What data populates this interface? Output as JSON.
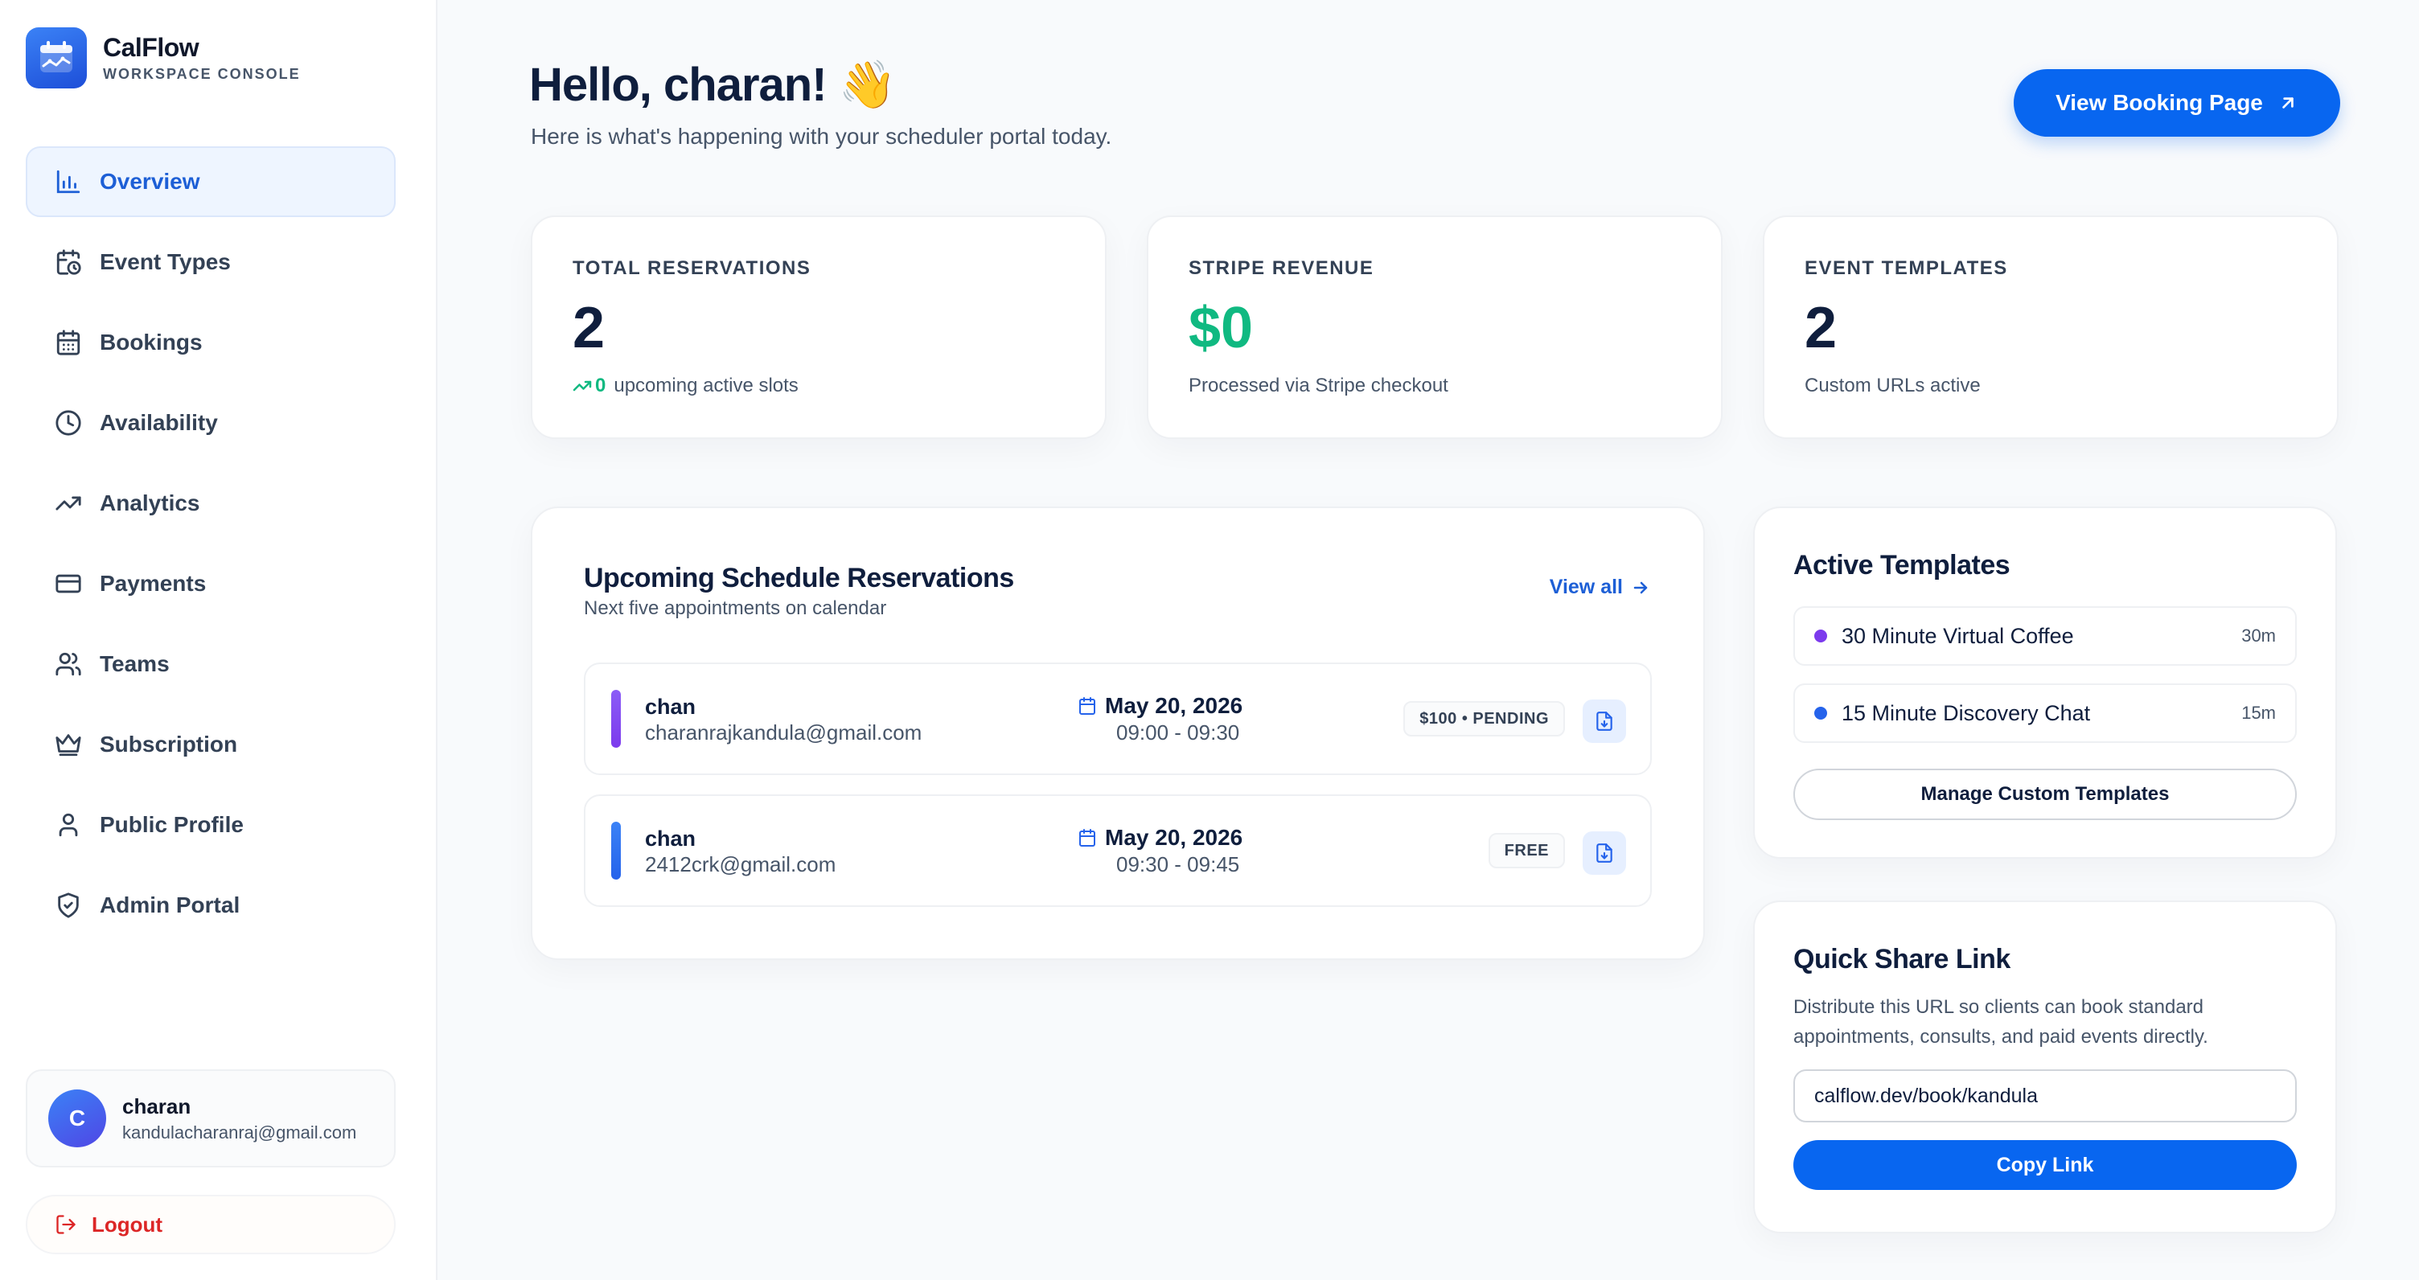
{
  "brand": {
    "name": "CalFlow",
    "subtitle": "WORKSPACE CONSOLE"
  },
  "sidebar": {
    "items": [
      {
        "label": "Overview",
        "icon": "bar-chart-icon",
        "active": true
      },
      {
        "label": "Event Types",
        "icon": "calendar-clock-icon"
      },
      {
        "label": "Bookings",
        "icon": "calendar-icon"
      },
      {
        "label": "Availability",
        "icon": "clock-icon"
      },
      {
        "label": "Analytics",
        "icon": "trending-up-icon"
      },
      {
        "label": "Payments",
        "icon": "credit-card-icon"
      },
      {
        "label": "Teams",
        "icon": "users-icon"
      },
      {
        "label": "Subscription",
        "icon": "crown-icon"
      },
      {
        "label": "Public Profile",
        "icon": "user-icon"
      },
      {
        "label": "Admin Portal",
        "icon": "shield-icon"
      }
    ],
    "user": {
      "initial": "C",
      "name": "charan",
      "email": "kandulacharanraj@gmail.com"
    },
    "logout_label": "Logout"
  },
  "header": {
    "greeting": "Hello, charan! 👋",
    "subtitle": "Here is what's happening with your scheduler portal today.",
    "view_booking_label": "View Booking Page"
  },
  "stats": [
    {
      "label": "TOTAL RESERVATIONS",
      "value": "2",
      "trend": "0",
      "foot": "upcoming active slots"
    },
    {
      "label": "STRIPE REVENUE",
      "value": "$0",
      "foot": "Processed via Stripe checkout"
    },
    {
      "label": "EVENT TEMPLATES",
      "value": "2",
      "foot": "Custom URLs active"
    }
  ],
  "reservations": {
    "title": "Upcoming Schedule Reservations",
    "subtitle": "Next five appointments on calendar",
    "view_all_label": "View all",
    "rows": [
      {
        "name": "chan",
        "email": "charanrajkandula@gmail.com",
        "date": "May 20, 2026",
        "time": "09:00 - 09:30",
        "badge": "$100 • PENDING",
        "bar_color": "#7c3aed"
      },
      {
        "name": "chan",
        "email": "2412crk@gmail.com",
        "date": "May 20, 2026",
        "time": "09:30 - 09:45",
        "badge": "FREE",
        "bar_color": "#2563eb"
      }
    ]
  },
  "templates": {
    "title": "Active Templates",
    "items": [
      {
        "name": "30 Minute Virtual Coffee",
        "duration": "30m",
        "color": "#7c3aed"
      },
      {
        "name": "15 Minute Discovery Chat",
        "duration": "15m",
        "color": "#2563eb"
      }
    ],
    "manage_label": "Manage Custom Templates"
  },
  "share": {
    "title": "Quick Share Link",
    "description": "Distribute this URL so clients can book standard appointments, consults, and paid events directly.",
    "url": "calflow.dev/book/kandula",
    "copy_label": "Copy Link"
  },
  "colors": {
    "accent": "#0866f0",
    "success": "#10b981",
    "danger": "#dc2626"
  }
}
